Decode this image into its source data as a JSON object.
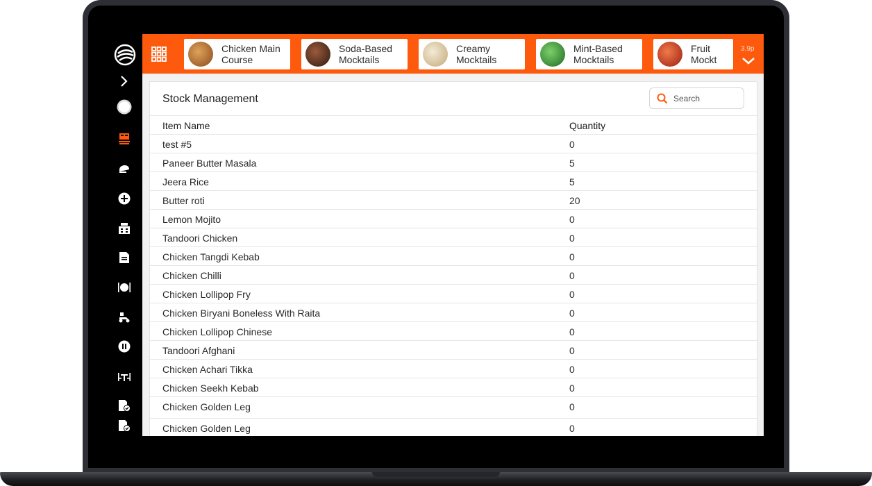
{
  "header": {
    "categories": [
      {
        "label": "Chicken Main\nCourse",
        "thumb_color": "#b5712f"
      },
      {
        "label": "Soda-Based\nMocktails",
        "thumb_color": "#5a3424"
      },
      {
        "label": "Creamy\nMocktails",
        "thumb_color": "#d9cbb0"
      },
      {
        "label": "Mint-Based\nMocktails",
        "thumb_color": "#3f9a3a"
      },
      {
        "label": "Fruit Mockt",
        "thumb_color": "#c93a2a"
      }
    ],
    "version": "3.9p"
  },
  "panel": {
    "title": "Stock Management",
    "search_placeholder": "Search",
    "columns": [
      "Item Name",
      "Quantity"
    ],
    "rows": [
      {
        "name": "test #5",
        "qty": "0"
      },
      {
        "name": "Paneer Butter Masala",
        "qty": "5"
      },
      {
        "name": "Jeera Rice",
        "qty": "5"
      },
      {
        "name": "Butter roti",
        "qty": "20"
      },
      {
        "name": "Lemon Mojito",
        "qty": "0"
      },
      {
        "name": "Tandoori Chicken",
        "qty": "0"
      },
      {
        "name": "Chicken Tangdi Kebab",
        "qty": "0"
      },
      {
        "name": "Chicken Chilli",
        "qty": "0"
      },
      {
        "name": "Chicken Lollipop Fry",
        "qty": "0"
      },
      {
        "name": "Chicken Biryani Boneless With Raita",
        "qty": "0"
      },
      {
        "name": "Chicken Lollipop Chinese",
        "qty": "0"
      },
      {
        "name": "Tandoori Afghani",
        "qty": "0"
      },
      {
        "name": "Chicken Achari Tikka",
        "qty": "0"
      },
      {
        "name": "Chicken Seekh Kebab",
        "qty": "0"
      },
      {
        "name": "Chicken Golden Leg",
        "qty": "0"
      },
      {
        "name": "Chicken Golden Leg",
        "qty": "0"
      }
    ]
  },
  "sidebar": {
    "icons": [
      "logo-icon",
      "chevron-right-icon",
      "avatar",
      "stock-icon",
      "chef-hat-icon",
      "add-icon",
      "inventory-icon",
      "document-icon",
      "dining-icon",
      "delivery-icon",
      "pause-icon",
      "tables-icon",
      "report-check-icon",
      "report-check-icon"
    ]
  },
  "colors": {
    "accent": "#fe5a0e",
    "sidebar": "#000000",
    "active_icon": "#fe5a0e"
  }
}
